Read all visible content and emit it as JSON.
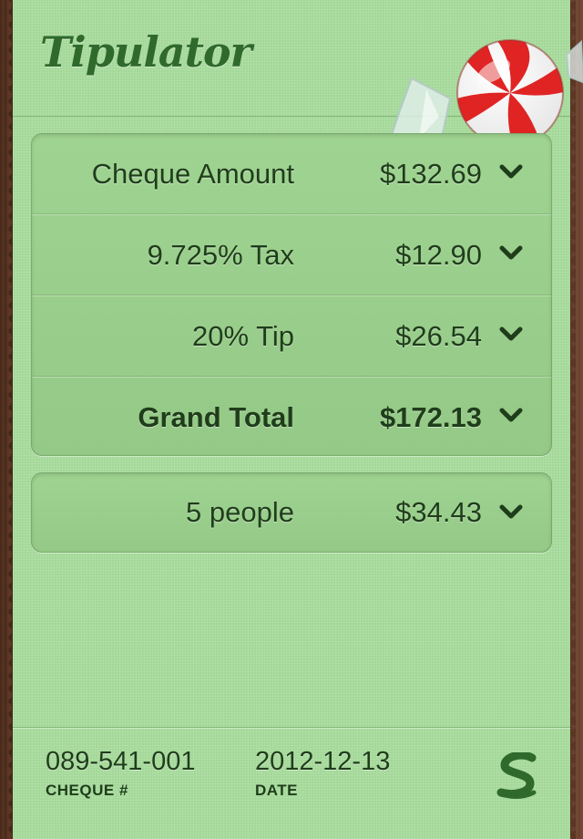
{
  "app": {
    "title": "Tipulator"
  },
  "colors": {
    "paper": "#a9dd9d",
    "text": "#1f3d1b",
    "logo": "#2f6a2c",
    "candy_red": "#e02020"
  },
  "bill_panel": {
    "rows": [
      {
        "label": "Cheque Amount",
        "value": "$132.69"
      },
      {
        "label": "9.725% Tax",
        "value": "$12.90"
      },
      {
        "label": "20% Tip",
        "value": "$26.54"
      },
      {
        "label": "Grand Total",
        "value": "$172.13"
      }
    ]
  },
  "split_panel": {
    "label": "5 people",
    "value": "$34.43"
  },
  "footer": {
    "cheque_number": "089-541-001",
    "cheque_caption": "CHEQUE #",
    "date": "2012-12-13",
    "date_caption": "DATE"
  },
  "icons": {
    "chevron": "chevron-down-icon",
    "candy": "peppermint-candy-icon",
    "brand": "s-logo-icon"
  }
}
